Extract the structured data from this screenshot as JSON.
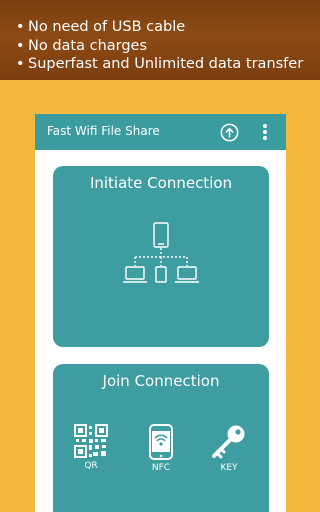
{
  "promo": {
    "items": [
      "No need of USB cable",
      "No data charges",
      "Superfast and Unlimited data transfer"
    ],
    "bullet": "•"
  },
  "appbar": {
    "title": "Fast Wifi File Share",
    "icons": [
      "upload-icon",
      "overflow-menu-icon"
    ]
  },
  "initiate": {
    "title": "Initiate Connection",
    "icon": "network-share-icon"
  },
  "join": {
    "title": "Join Connection",
    "options": [
      {
        "label": "QR",
        "icon": "qr-code-icon"
      },
      {
        "label": "NFC",
        "icon": "nfc-phone-icon"
      },
      {
        "label": "KEY",
        "icon": "key-icon"
      }
    ]
  },
  "colors": {
    "background": "#f4b83e",
    "banner": "#8d4a14",
    "teal": "#3b9ca0",
    "white": "#ffffff"
  }
}
